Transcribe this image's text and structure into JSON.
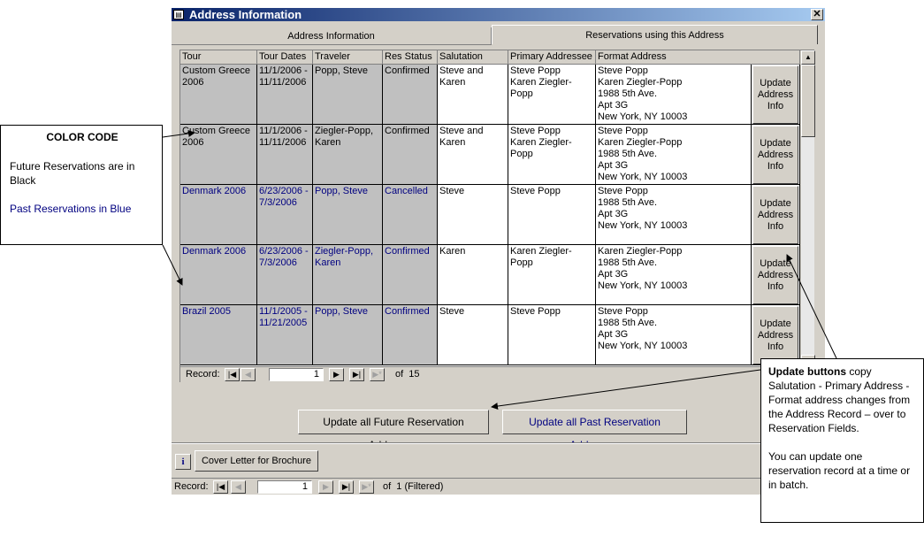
{
  "window": {
    "title": "Address Information",
    "close_glyph": "✕"
  },
  "tabs": [
    {
      "label": "Address Information"
    },
    {
      "label": "Reservations using this Address"
    }
  ],
  "grid": {
    "columns": [
      "Tour",
      "Tour Dates",
      "Traveler",
      "Res Status",
      "Salutation",
      "Primary Addressee",
      "Format Address"
    ],
    "rows": [
      {
        "tour": "Custom Greece 2006",
        "dates": "11/1/2006 - 11/11/2006",
        "traveler": "Popp, Steve",
        "status": "Confirmed",
        "salutation": "Steve and Karen",
        "primary": [
          "Steve Popp",
          "Karen Ziegler-Popp"
        ],
        "address": [
          "Steve Popp",
          "Karen Ziegler-Popp",
          "1988 5th Ave.",
          "Apt 3G",
          "New York, NY  10003"
        ],
        "past": false
      },
      {
        "tour": "Custom Greece 2006",
        "dates": "11/1/2006 - 11/11/2006",
        "traveler": "Ziegler-Popp, Karen",
        "status": "Confirmed",
        "salutation": "Steve and Karen",
        "primary": [
          "Steve Popp",
          "Karen Ziegler-Popp"
        ],
        "address": [
          "Steve Popp",
          "Karen Ziegler-Popp",
          "1988 5th Ave.",
          "Apt 3G",
          "New York, NY  10003"
        ],
        "past": false
      },
      {
        "tour": "Denmark 2006",
        "dates": "6/23/2006 - 7/3/2006",
        "traveler": "Popp, Steve",
        "status": "Cancelled",
        "salutation": "Steve",
        "primary": [
          "Steve Popp"
        ],
        "address": [
          "Steve Popp",
          "1988 5th Ave.",
          "Apt 3G",
          "New York, NY  10003"
        ],
        "past": true
      },
      {
        "tour": "Denmark 2006",
        "dates": "6/23/2006 - 7/3/2006",
        "traveler": "Ziegler-Popp, Karen",
        "status": "Confirmed",
        "salutation": "Karen",
        "primary": [
          "Karen Ziegler-Popp"
        ],
        "address": [
          "Karen Ziegler-Popp",
          "1988 5th Ave.",
          "Apt 3G",
          "New York, NY  10003"
        ],
        "past": true
      },
      {
        "tour": "Brazil 2005",
        "dates": "11/1/2005 - 11/21/2005",
        "traveler": "Popp, Steve",
        "status": "Confirmed",
        "salutation": "Steve",
        "primary": [
          "Steve Popp"
        ],
        "address": [
          "Steve Popp",
          "1988 5th Ave.",
          "Apt 3G",
          "New York, NY  10003"
        ],
        "past": true
      }
    ],
    "update_button_label": "Update Address Info"
  },
  "subnav": {
    "label": "Record:",
    "current": "1",
    "of_text": "of  15"
  },
  "buttons": {
    "update_future": "Update all Future Reservation Addresses",
    "update_past": "Update all Past Reservation Addresses",
    "cover_letter": "Cover Letter for Brochure",
    "info_glyph": "i"
  },
  "mainnav": {
    "label": "Record:",
    "current": "1",
    "of_text": "of  1 (Filtered)"
  },
  "nav_glyphs": {
    "first": "|◀",
    "prev": "◀",
    "next": "▶",
    "last": "▶|",
    "new": "▶*"
  },
  "callouts": {
    "color_code": {
      "title": "COLOR CODE",
      "future": "Future Reservations are in Black",
      "past": "Past Reservations in Blue"
    },
    "update": {
      "bold": "Update buttons",
      "text": " copy Salutation - Primary Address - Format address changes from the Address Record – over to Reservation Fields.",
      "text2": "You can update one reservation record at a time or in batch."
    }
  },
  "colors": {
    "past_text": "#000080",
    "titlebar": "#0a246a",
    "face": "#d4d0c8"
  }
}
